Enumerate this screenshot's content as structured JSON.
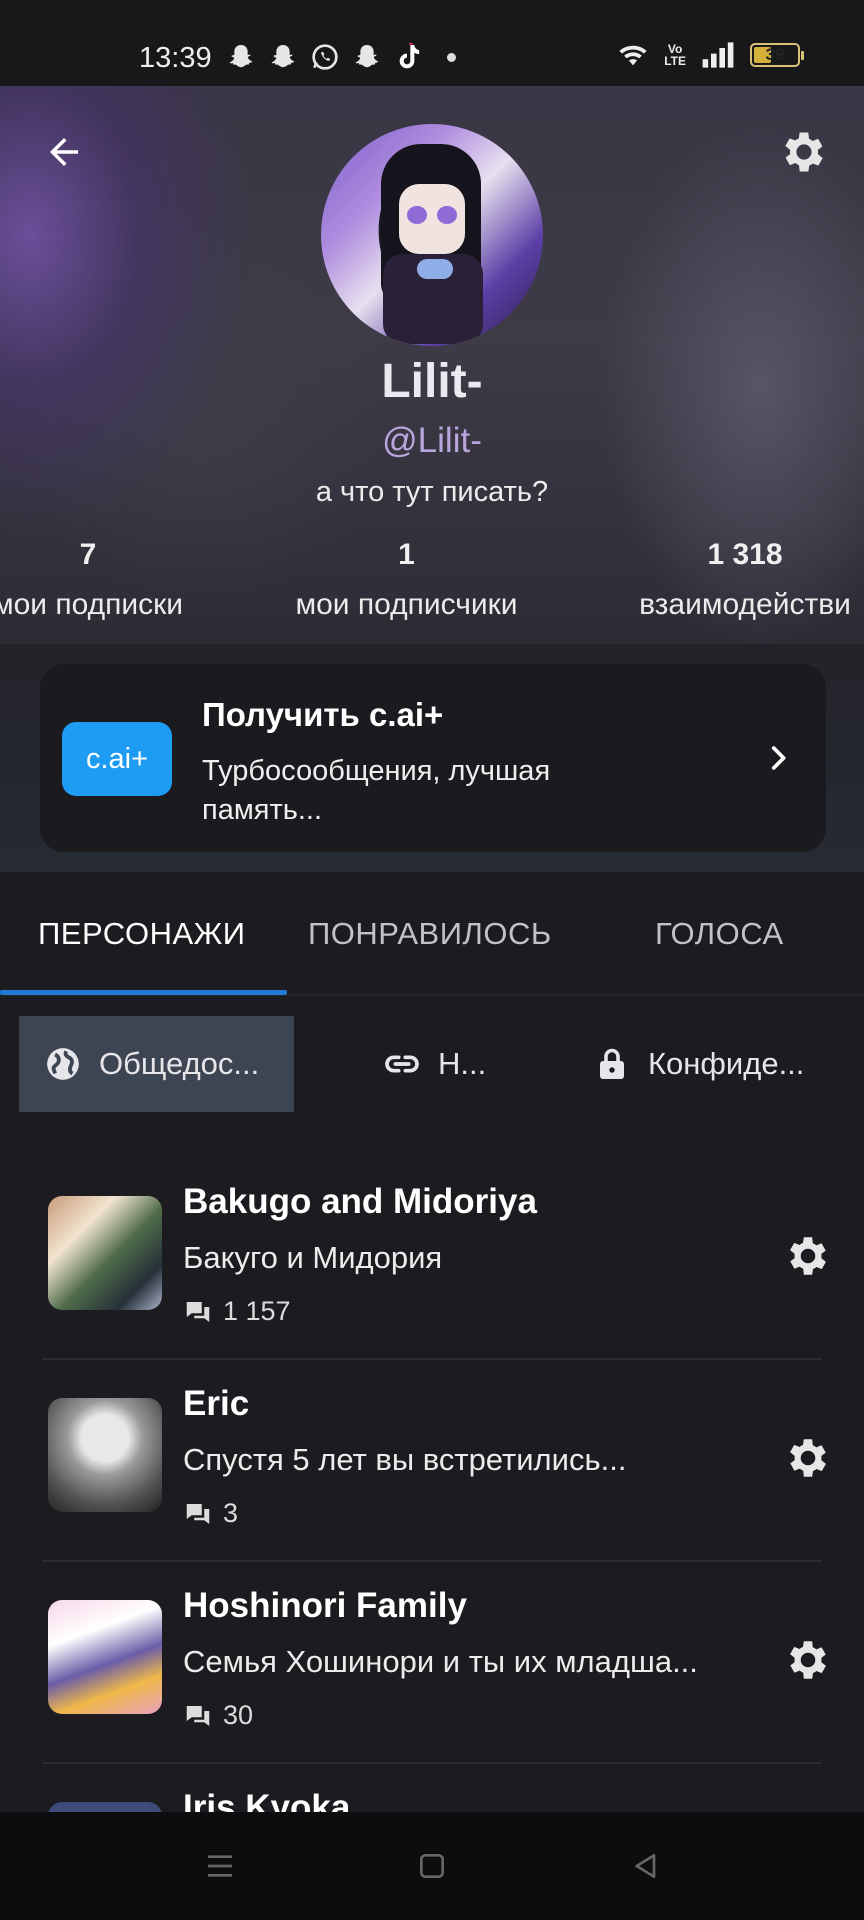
{
  "status_bar": {
    "time": "13:39",
    "battery": "39",
    "volte": "Vo\nLTE",
    "icons": [
      "snapchat-icon",
      "snapchat-icon",
      "whatsapp-icon",
      "snapchat-icon",
      "tiktok-icon",
      "dot-icon",
      "wifi-icon",
      "signal-icon",
      "battery-icon"
    ]
  },
  "header": {
    "back_icon": "arrow-left-icon",
    "settings_icon": "gear-icon",
    "name": "Lilit-",
    "handle": "@Lilit-",
    "bio": "а что тут писать?",
    "stats": [
      {
        "value": "7",
        "label": "мои подписки"
      },
      {
        "value": "1",
        "label": "мои подписчики"
      },
      {
        "value": "1 318",
        "label": "взаимодействи"
      }
    ]
  },
  "promo": {
    "badge": "c.ai+",
    "title": "Получить c.ai+",
    "subtitle": "Турбосообщения, лучшая память...",
    "accent": "#1e9bf3"
  },
  "tabs": [
    {
      "label": "ПЕРСОНАЖИ",
      "active": true
    },
    {
      "label": "ПОНРАВИЛОСЬ",
      "active": false
    },
    {
      "label": "ГОЛОСА",
      "active": false
    }
  ],
  "filters": [
    {
      "label": "Общедос...",
      "icon": "globe-icon",
      "selected": true
    },
    {
      "label": "Н...",
      "icon": "link-icon",
      "selected": false
    },
    {
      "label": "Конфиде...",
      "icon": "lock-icon",
      "selected": false
    }
  ],
  "characters": [
    {
      "title": "Bakugo and Midoriya",
      "subtitle": "Бакуго и Мидория",
      "count": "1 157"
    },
    {
      "title": "Eric",
      "subtitle": "Спустя 5 лет вы встретились...",
      "count": "3"
    },
    {
      "title": "Hoshinori Family",
      "subtitle": "Семья Хошинори и ты их младша...",
      "count": "30"
    },
    {
      "title": "Iris Kyoka",
      "subtitle": "",
      "count": ""
    }
  ],
  "colors": {
    "background": "#1c1c20",
    "tab_indicator": "#1f7bd4",
    "filter_selected": "#3d4452",
    "handle": "#b9a6dd"
  }
}
